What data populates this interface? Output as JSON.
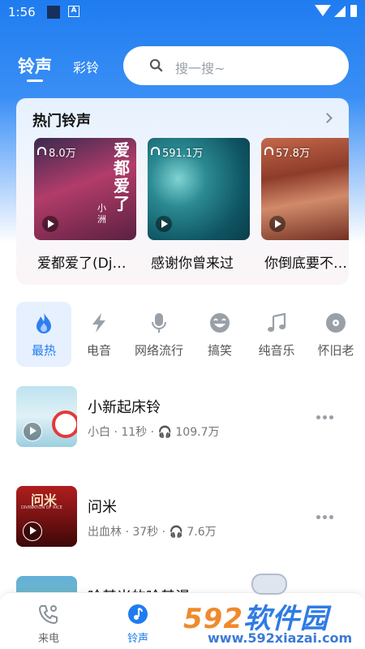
{
  "status_bar": {
    "time": "1:56",
    "a_label": "A"
  },
  "header": {
    "tabs": [
      {
        "label": "铃声",
        "active": true
      },
      {
        "label": "彩铃",
        "active": false
      }
    ],
    "search": {
      "placeholder": "搜一搜~"
    }
  },
  "hot": {
    "title": "热门铃声",
    "items": [
      {
        "title": "爱都爱了(Dj…",
        "plays": "8.0万",
        "cover_text": "爱都爱了",
        "cover_sub": "小 洲"
      },
      {
        "title": "感谢你曾来过",
        "plays": "591.1万"
      },
      {
        "title": "你倒底要不…",
        "plays": "57.8万"
      }
    ]
  },
  "categories": [
    {
      "label": "最热",
      "icon": "flame-icon",
      "active": true
    },
    {
      "label": "电音",
      "icon": "lightning-icon",
      "active": false
    },
    {
      "label": "网络流行",
      "icon": "microphone-icon",
      "active": false
    },
    {
      "label": "搞笑",
      "icon": "laugh-face-icon",
      "active": false
    },
    {
      "label": "纯音乐",
      "icon": "music-note-icon",
      "active": false
    },
    {
      "label": "怀旧老",
      "icon": "vinyl-disc-icon",
      "active": false
    }
  ],
  "songs": [
    {
      "title": "小新起床铃",
      "meta": "小白 · 11秒 · 🎧 109.7万"
    },
    {
      "title": "问米",
      "meta": "出血林 · 37秒 · 🎧 7.6万",
      "cover_text": "问米",
      "cover_sub": "DIVINATION OF RICE"
    },
    {
      "title": "哈基米的哈基漫"
    }
  ],
  "bottom_nav": [
    {
      "label": "来电",
      "icon": "incoming-call-icon",
      "active": false
    },
    {
      "label": "铃声",
      "icon": "music-note-circle-icon",
      "active": true
    }
  ],
  "watermark": {
    "num": "592",
    "cn": "软件园",
    "url": "www.592xiazai.com"
  },
  "colors": {
    "accent": "#1f7cf0",
    "watermark_orange": "#f08a2c"
  }
}
